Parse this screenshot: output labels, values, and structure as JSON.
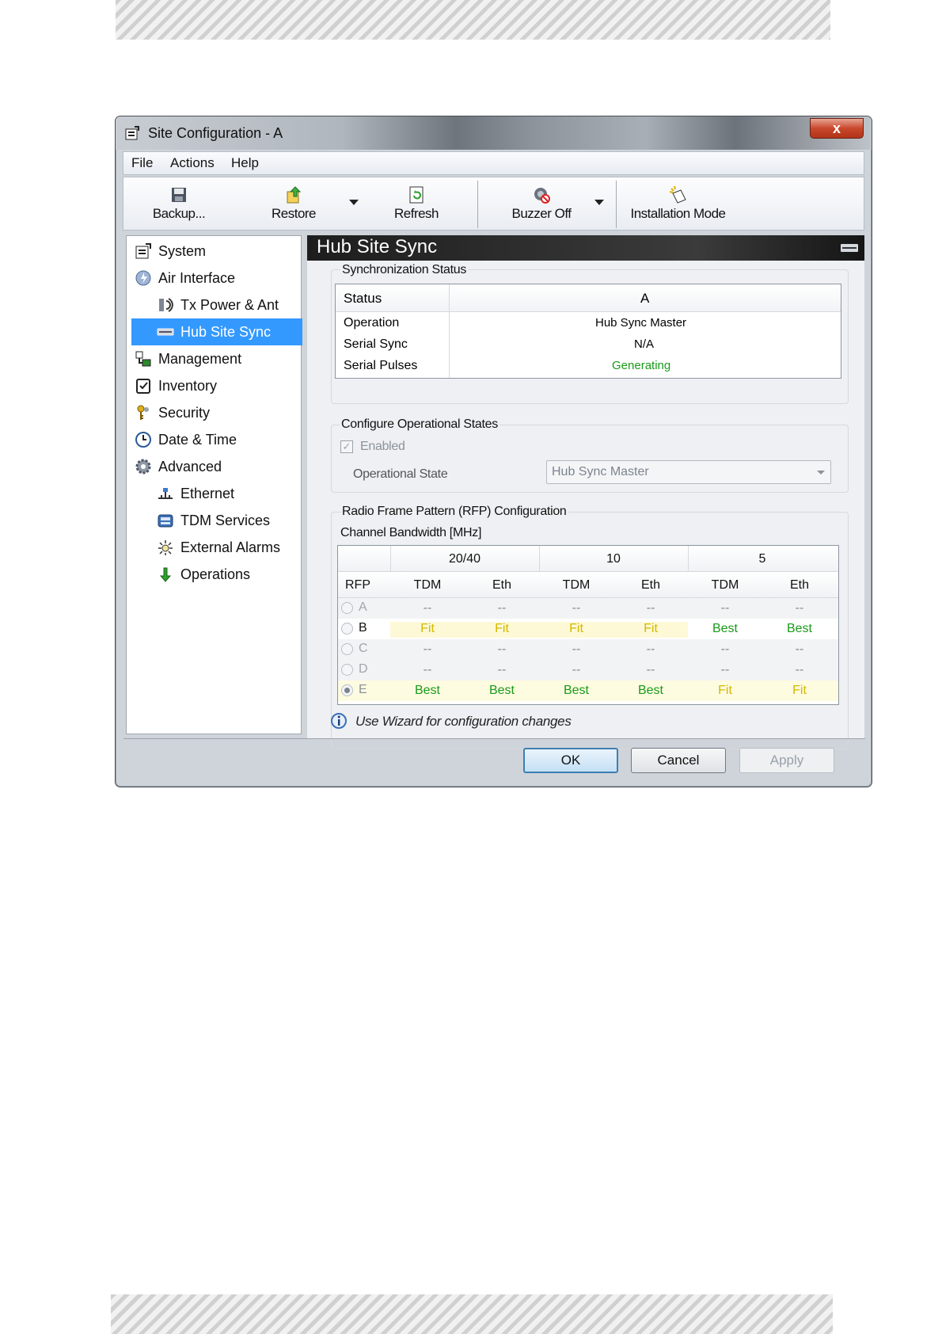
{
  "window": {
    "title": "Site Configuration - A",
    "close_label": "x"
  },
  "menu": [
    "File",
    "Actions",
    "Help"
  ],
  "toolbar": {
    "backup": "Backup...",
    "restore": "Restore",
    "refresh": "Refresh",
    "buzzer": "Buzzer Off",
    "installation": "Installation Mode"
  },
  "nav": [
    {
      "label": "System",
      "icon": "system-icon"
    },
    {
      "label": "Air Interface",
      "icon": "air-interface-icon"
    },
    {
      "label": "Tx Power & Ant",
      "icon": "antenna-icon"
    },
    {
      "label": "Hub Site Sync",
      "icon": "hub-sync-icon"
    },
    {
      "label": "Management",
      "icon": "management-icon"
    },
    {
      "label": "Inventory",
      "icon": "inventory-icon"
    },
    {
      "label": "Security",
      "icon": "security-icon"
    },
    {
      "label": "Date & Time",
      "icon": "clock-icon"
    },
    {
      "label": "Advanced",
      "icon": "gear-icon"
    },
    {
      "label": "Ethernet",
      "icon": "ethernet-icon"
    },
    {
      "label": "TDM Services",
      "icon": "tdm-icon"
    },
    {
      "label": "External Alarms",
      "icon": "alarm-icon"
    },
    {
      "label": "Operations",
      "icon": "operations-icon"
    }
  ],
  "panel": {
    "title": "Hub Site Sync",
    "sync_status": {
      "group_label": "Synchronization Status",
      "header": [
        "Status",
        "A"
      ],
      "rows": [
        {
          "label": "Operation",
          "value": "Hub Sync Master"
        },
        {
          "label": "Serial Sync",
          "value": "N/A"
        },
        {
          "label": "Serial Pulses",
          "value": "Generating"
        }
      ]
    },
    "op_states": {
      "group_label": "Configure Operational States",
      "enabled_label": "Enabled",
      "enabled_checked": true,
      "state_label": "Operational State",
      "state_value": "Hub Sync Master"
    },
    "rfp": {
      "group_label": "Radio Frame Pattern (RFP) Configuration",
      "bandwidth_label": "Channel Bandwidth [MHz]",
      "bandwidths": [
        "20/40",
        "10",
        "5"
      ],
      "columns": [
        "RFP",
        "TDM",
        "Eth",
        "TDM",
        "Eth",
        "TDM",
        "Eth"
      ],
      "rows": [
        {
          "rfp": "A",
          "values": [
            "--",
            "--",
            "--",
            "--",
            "--",
            "--"
          ],
          "selected": false
        },
        {
          "rfp": "B",
          "values": [
            "Fit",
            "Fit",
            "Fit",
            "Fit",
            "Best",
            "Best"
          ],
          "selected": false
        },
        {
          "rfp": "C",
          "values": [
            "--",
            "--",
            "--",
            "--",
            "--",
            "--"
          ],
          "selected": false
        },
        {
          "rfp": "D",
          "values": [
            "--",
            "--",
            "--",
            "--",
            "--",
            "--"
          ],
          "selected": false
        },
        {
          "rfp": "E",
          "values": [
            "Best",
            "Best",
            "Best",
            "Best",
            "Fit",
            "Fit"
          ],
          "selected": true
        }
      ]
    },
    "info_text": "Use Wizard for configuration changes"
  },
  "buttons": {
    "ok": "OK",
    "cancel": "Cancel",
    "apply": "Apply"
  },
  "colors": {
    "fit": "#d4b800",
    "best": "#1a9a1a",
    "generating": "#1a9a1a",
    "selection": "#3399ff"
  }
}
